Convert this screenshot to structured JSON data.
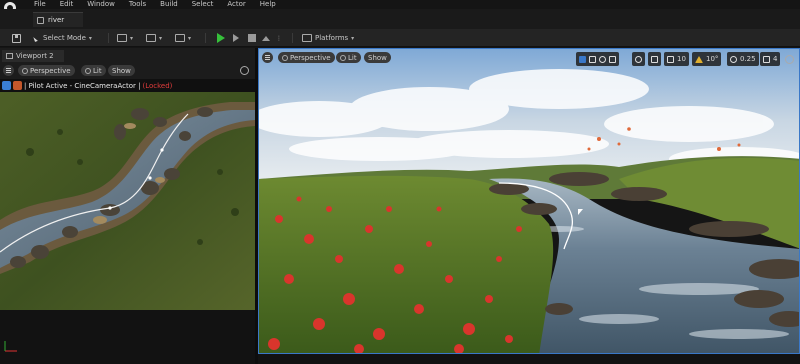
{
  "menu": {
    "items": [
      "File",
      "Edit",
      "Window",
      "Tools",
      "Build",
      "Select",
      "Actor",
      "Help"
    ]
  },
  "level_tab": {
    "name": "river"
  },
  "toolbar": {
    "mode_label": "Select Mode",
    "platforms_label": "Platforms"
  },
  "left_viewport": {
    "tab_label": "Viewport 2",
    "perspective_label": "Perspective",
    "lit_label": "Lit",
    "show_label": "Show",
    "pilot_text": "| Pilot Active - CineCameraActor |",
    "locked_text": "(Locked)"
  },
  "right_viewport": {
    "perspective_label": "Perspective",
    "lit_label": "Lit",
    "show_label": "Show",
    "grid_snap_value": "10",
    "rotation_snap_value": "10°",
    "scale_snap_value": "0.25",
    "camera_speed_value": "4"
  },
  "colors": {
    "accent_blue": "#3a78c8",
    "play_green": "#36c03b",
    "locked_red": "#e13c3c"
  }
}
